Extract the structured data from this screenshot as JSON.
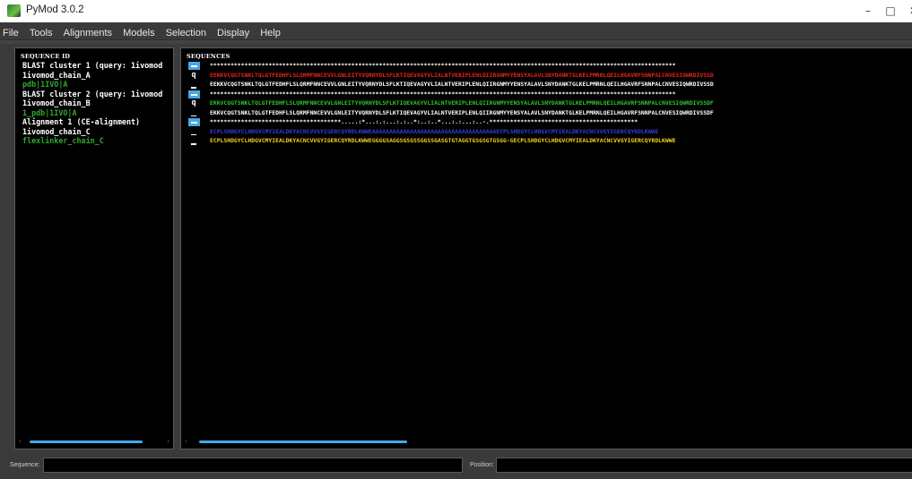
{
  "window": {
    "title": "PyMod 3.0.2",
    "controls": {
      "minimize": "–",
      "maximize": "□",
      "close": "✕"
    }
  },
  "menu": [
    "File",
    "Tools",
    "Alignments",
    "Models",
    "Selection",
    "Display",
    "Help"
  ],
  "left_panel": {
    "header": "SEQUENCE ID",
    "rows": [
      {
        "text": "BLAST cluster 1 (query: 1ivomod",
        "color": "#ffffff"
      },
      {
        "text": "1ivomod_chain_A",
        "color": "#ffffff"
      },
      {
        "text": "pdb|1IVO|A",
        "color": "#2fa82f"
      },
      {
        "text": "BLAST cluster 2 (query: 1ivomod",
        "color": "#ffffff"
      },
      {
        "text": "1ivomod_chain_B",
        "color": "#ffffff"
      },
      {
        "text": "1_pdb|1IVO|A",
        "color": "#2fa82f"
      },
      {
        "text": "Alignment 1 (CE-alignment)",
        "color": "#ffffff"
      },
      {
        "text": "1ivomod_chain_C",
        "color": "#ffffff"
      },
      {
        "text": "flexlinker_chain_C",
        "color": "#2fa82f"
      }
    ]
  },
  "right_panel": {
    "header": "SEQUENCES",
    "rows": [
      {
        "marker": "box",
        "marker_label": "",
        "text": "***************************************************************************************************************************************",
        "color": "#ffffff"
      },
      {
        "marker": "q",
        "marker_label": "q",
        "text": "EEKKVCQGTSNKLTQLGTFEDHFLSLQRMFNNCEVVLGNLEITYVQRNYDLSFLKTIQEVAGYVLIALNTVERIPLENLQIIRGNMYYENSYALAVLSNYDANKTGLKELPMRNLQEILHGAVRFSNNPALCNVESIQWRDIVSSD",
        "color": "#e8231e"
      },
      {
        "marker": "dash",
        "marker_label": "",
        "text": "EEKKVCQGTSNKLTQLGTFEDHFLSLQRMFNNCEVVLGNLEITYVQRNYDLSFLKTIQEVAGYVLIALNTVERIPLENLQIIRGNMYYENSYALAVLSNYDANKTGLKELPMRNLQEILHGAVRFSNNPALCNVESIQWRDIVSSD",
        "color": "#ffffff"
      },
      {
        "marker": "box",
        "marker_label": "",
        "text": "***************************************************************************************************************************************",
        "color": "#ffffff"
      },
      {
        "marker": "q",
        "marker_label": "q",
        "text": "EKKVCQGTSNKLTQLGTFEDHFLSLQRMFNNCEVVLGNLEITYVQRNYDLSFLKTIQEVAGYVLIALNTVERIPLENLQIIRGNMYYENSYALAVLSNYDANKTGLKELPMRNLQEILHGAVRFSNNPALCNVESIQWRDIVSSDF",
        "color": "#2ec42e"
      },
      {
        "marker": "dash",
        "marker_label": "",
        "text": "EKKVCQGTSNKLTQLGTFEDHFLSLQRMFNNCEVVLGNLEITYVQRNYDLSFLKTIQEVAGYVLIALNTVERIPLENLQIIRGNMYYENSYALAVLSNYDANKTGLKELPMRNLQEILHGAVRFSNNPALCNVESIQWRDIVSSDF",
        "color": "#ffffff"
      },
      {
        "marker": "box",
        "marker_label": "",
        "text": "**************************************.....:*...:.:...:.:..*:..:..*...:.:...:..-.*******************************************",
        "color": "#ffffff"
      },
      {
        "marker": "dash",
        "marker_label": "",
        "text": "ECPLSHDGYCLHDGVCMYIEALDKYACNCVVGYIGERCQYRDLKWWEAAAAAAAAAAAAAAAAAAAAAAAAAAAAAAAAAAAAECPLSHDGYCLHDGVCMYIEALDKYACNCVVGYIGERCQYRDLKWWE",
        "color": "#2f3fd8"
      },
      {
        "marker": "dash",
        "marker_label": "",
        "text": "ECPLSHDGYCLHDGVCMYIEALDKYACNCVVGYIGERCQYRDLKWWEGGGGSAGGSGSGSSGGSSGASGTGTAGGTGSGSGTGSGG-GECPLSHDGYCLHDGVCMYIEALDKYACNCVVGYIGERCQYRDLKWWE",
        "color": "#f3d21a"
      }
    ]
  },
  "statusbar": {
    "sequence_label": "Sequence:",
    "position_label": "Position:"
  },
  "colors": {
    "accent": "#48a8e8",
    "background": "#3b3b3b",
    "panel": "#000000"
  }
}
